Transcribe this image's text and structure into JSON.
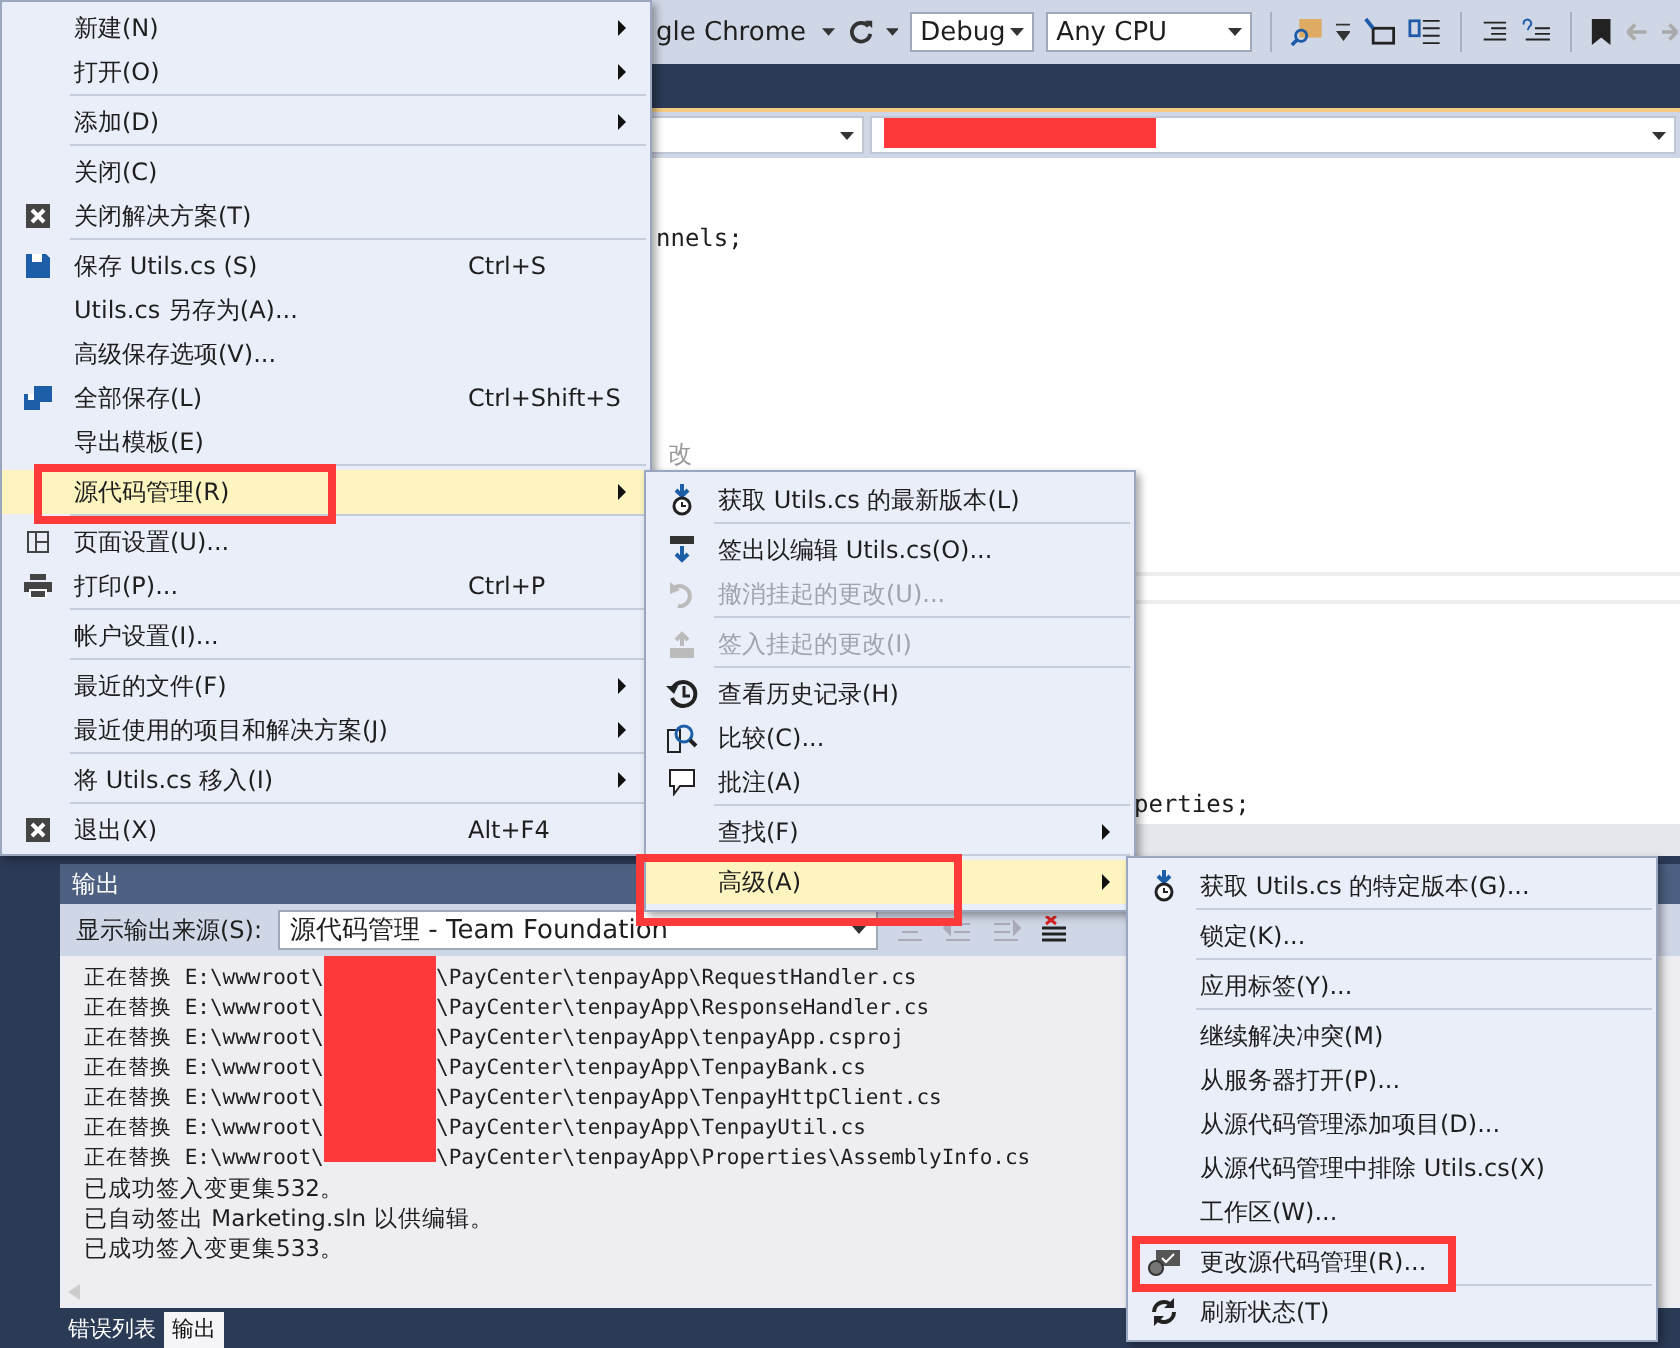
{
  "toolbar": {
    "startup_target": "gle Chrome",
    "configuration": "Debug",
    "platform": "Any CPU"
  },
  "editor": {
    "code_lines": [
      {
        "kind": "code",
        "text": "nnels;"
      },
      {
        "kind": "comment",
        "text": "改"
      },
      {
        "kind": "code",
        "text": "perties;"
      }
    ]
  },
  "output": {
    "title": "输出",
    "source_label": "显示输出来源(S):",
    "source_value": "源代码管理 - Team Foundation",
    "lines": [
      {
        "kind": "path",
        "prefix": "正在替换 E:\\wwwroot\\",
        "suffix": "\\PayCenter\\tenpayApp\\RequestHandler.cs"
      },
      {
        "kind": "path",
        "prefix": "正在替换 E:\\wwwroot\\",
        "suffix": "\\PayCenter\\tenpayApp\\ResponseHandler.cs"
      },
      {
        "kind": "path",
        "prefix": "正在替换 E:\\wwwroot\\",
        "suffix": "\\PayCenter\\tenpayApp\\tenpayApp.csproj"
      },
      {
        "kind": "path",
        "prefix": "正在替换 E:\\wwwroot\\",
        "suffix": "\\PayCenter\\tenpayApp\\TenpayBank.cs"
      },
      {
        "kind": "path",
        "prefix": "正在替换 E:\\wwwroot\\",
        "suffix": "\\PayCenter\\tenpayApp\\TenpayHttpClient.cs"
      },
      {
        "kind": "path",
        "prefix": "正在替换 E:\\wwwroot\\",
        "suffix": "\\PayCenter\\tenpayApp\\TenpayUtil.cs"
      },
      {
        "kind": "path",
        "prefix": "正在替换 E:\\wwwroot\\",
        "suffix": "\\PayCenter\\tenpayApp\\Properties\\AssemblyInfo.cs"
      },
      {
        "kind": "message",
        "text": "已成功签入变更集532。"
      },
      {
        "kind": "message",
        "text": "已自动签出 Marketing.sln 以供编辑。"
      },
      {
        "kind": "message",
        "text": "已成功签入变更集533。"
      }
    ]
  },
  "bottom_tabs": [
    {
      "label": "错误列表",
      "selected": false
    },
    {
      "label": "输出",
      "selected": true
    }
  ],
  "file_menu": {
    "groups": [
      [
        {
          "label": "新建(N)",
          "submenu": true,
          "selected": false
        },
        {
          "label": "打开(O)",
          "submenu": true,
          "selected": false
        }
      ],
      [
        {
          "label": "添加(D)",
          "submenu": true,
          "selected": false
        }
      ],
      [
        {
          "label": "关闭(C)",
          "submenu": false,
          "selected": false
        },
        {
          "label": "关闭解决方案(T)",
          "submenu": false,
          "selected": false
        }
      ],
      [
        {
          "label": "保存 Utils.cs (S)",
          "shortcut": "Ctrl+S",
          "submenu": false,
          "selected": false
        },
        {
          "label": "Utils.cs 另存为(A)...",
          "submenu": false,
          "selected": false
        },
        {
          "label": "高级保存选项(V)...",
          "submenu": false,
          "selected": false
        },
        {
          "label": "全部保存(L)",
          "shortcut": "Ctrl+Shift+S",
          "submenu": false,
          "selected": false
        },
        {
          "label": "导出模板(E)",
          "submenu": false,
          "selected": false
        }
      ],
      [
        {
          "label": "源代码管理(R)",
          "submenu": true,
          "selected": true
        }
      ],
      [
        {
          "label": "页面设置(U)...",
          "submenu": false,
          "selected": false
        },
        {
          "label": "打印(P)...",
          "shortcut": "Ctrl+P",
          "submenu": false,
          "selected": false
        }
      ],
      [
        {
          "label": "帐户设置(I)...",
          "submenu": false,
          "selected": false
        }
      ],
      [
        {
          "label": "最近的文件(F)",
          "submenu": true,
          "selected": false
        },
        {
          "label": "最近使用的项目和解决方案(J)",
          "submenu": true,
          "selected": false
        }
      ],
      [
        {
          "label": "将 Utils.cs 移入(I)",
          "submenu": true,
          "selected": false
        }
      ],
      [
        {
          "label": "退出(X)",
          "shortcut": "Alt+F4",
          "submenu": false,
          "selected": false
        }
      ]
    ]
  },
  "source_control_menu": {
    "groups": [
      [
        {
          "label": "获取 Utils.cs 的最新版本(L)",
          "submenu": false,
          "selected": false,
          "disabled": false
        }
      ],
      [
        {
          "label": "签出以编辑 Utils.cs(O)...",
          "submenu": false,
          "selected": false,
          "disabled": false
        },
        {
          "label": "撤消挂起的更改(U)...",
          "submenu": false,
          "selected": false,
          "disabled": true
        }
      ],
      [
        {
          "label": "签入挂起的更改(I)",
          "submenu": false,
          "selected": false,
          "disabled": true
        }
      ],
      [
        {
          "label": "查看历史记录(H)",
          "submenu": false,
          "selected": false,
          "disabled": false
        },
        {
          "label": "比较(C)...",
          "submenu": false,
          "selected": false,
          "disabled": false
        },
        {
          "label": "批注(A)",
          "submenu": false,
          "selected": false,
          "disabled": false
        }
      ],
      [
        {
          "label": "查找(F)",
          "submenu": true,
          "selected": false,
          "disabled": false
        }
      ],
      [
        {
          "label": "高级(A)",
          "submenu": true,
          "selected": true,
          "disabled": false
        }
      ]
    ]
  },
  "advanced_menu": {
    "groups": [
      [
        {
          "label": "获取 Utils.cs 的特定版本(G)...",
          "selected": false
        }
      ],
      [
        {
          "label": "锁定(K)...",
          "selected": false
        }
      ],
      [
        {
          "label": "应用标签(Y)...",
          "selected": false
        }
      ],
      [
        {
          "label": "继续解决冲突(M)",
          "selected": false
        },
        {
          "label": "从服务器打开(P)...",
          "selected": false
        },
        {
          "label": "从源代码管理添加项目(D)...",
          "selected": false
        },
        {
          "label": "从源代码管理中排除 Utils.cs(X)",
          "selected": false
        },
        {
          "label": "工作区(W)...",
          "selected": false
        },
        {
          "label": "更改源代码管理(R)...",
          "selected": false
        }
      ],
      [
        {
          "label": "刷新状态(T)",
          "selected": false
        }
      ]
    ]
  }
}
